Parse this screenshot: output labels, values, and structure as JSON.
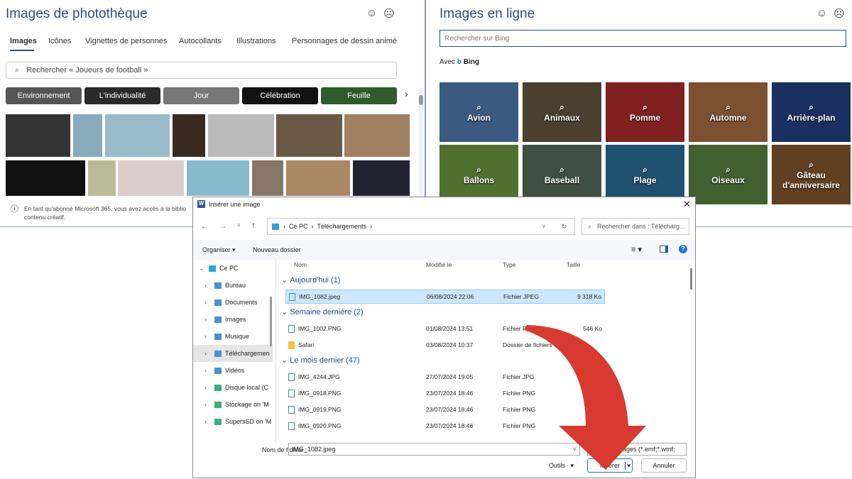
{
  "left": {
    "title": "Images de photothèque",
    "tabs": [
      "Images",
      "Icônes",
      "Vignettes de personnes",
      "Autocollants",
      "Illustrations",
      "Personnages de dessin animé"
    ],
    "search_placeholder": "Rechercher « Joueurs de football »",
    "chips": [
      "Environnement",
      "L'individualité",
      "Jour",
      "Célébration",
      "Feuille"
    ],
    "notice": "En tant qu'abonné Microsoft 365, vous avez accès à la biblio",
    "notice2": "contenu créatif."
  },
  "right": {
    "title": "Images en ligne",
    "search_placeholder": "Rechercher sur Bing",
    "avec": "Avec",
    "bing": "Bing",
    "categories": [
      "Avion",
      "Animaux",
      "Pomme",
      "Automne",
      "Arrière-plan",
      "Ballons",
      "Baseball",
      "Plage",
      "Oiseaux",
      "Gâteau d'anniversaire"
    ]
  },
  "dialog": {
    "title": "Insérer une image",
    "breadcrumb": [
      "Ce PC",
      "Téléchargements"
    ],
    "search_placeholder": "Rechercher dans : Télécharg...",
    "organiser": "Organiser",
    "new_folder": "Nouveau dossier",
    "columns": [
      "Nom",
      "Modifié le",
      "Type",
      "Taille"
    ],
    "nav": [
      "Ce PC",
      "Bureau",
      "Documents",
      "Images",
      "Musique",
      "Téléchargemen",
      "Vidéos",
      "Disque local (C",
      "Stockage on 'M",
      "SupersSD on 'M"
    ],
    "groups": [
      {
        "label": "Aujourd'hui (1)",
        "files": [
          {
            "name": "IMG_1082.jpeg",
            "date": "06/08/2024 22:06",
            "type": "Fichier JPEG",
            "size": "9 318 Ko"
          }
        ]
      },
      {
        "label": "Semaine dernière (2)",
        "files": [
          {
            "name": "IMG_1002.PNG",
            "date": "01/08/2024 13:51",
            "type": "Fichier PNG",
            "size": "546 Ko"
          },
          {
            "name": "Safari",
            "date": "03/08/2024 10:37",
            "type": "Dossier de fichiers",
            "size": ""
          }
        ]
      },
      {
        "label": "Le mois dernier (47)",
        "files": [
          {
            "name": "IMG_4244.JPG",
            "date": "27/07/2024 19:05",
            "type": "Fichier JPG",
            "size": ""
          },
          {
            "name": "IMG_0918.PNG",
            "date": "23/07/2024 18:46",
            "type": "Fichier PNG",
            "size": ""
          },
          {
            "name": "IMG_0919.PNG",
            "date": "23/07/2024 18:46",
            "type": "Fichier PNG",
            "size": ""
          },
          {
            "name": "IMG_0920.PNG",
            "date": "23/07/2024 18:46",
            "type": "Fichier PNG",
            "size": ""
          }
        ]
      }
    ],
    "filename_label": "Nom de fichier :",
    "filename": "IMG_1082.jpeg",
    "filter": "Tous les images (*.emf;*.wmf;",
    "tools": "Outils",
    "insert": "Insérer",
    "cancel": "Annuler"
  },
  "colors": {
    "accent": "#2b4f7e",
    "arrow": "#d93a2f",
    "selected": "#cce8ff"
  }
}
